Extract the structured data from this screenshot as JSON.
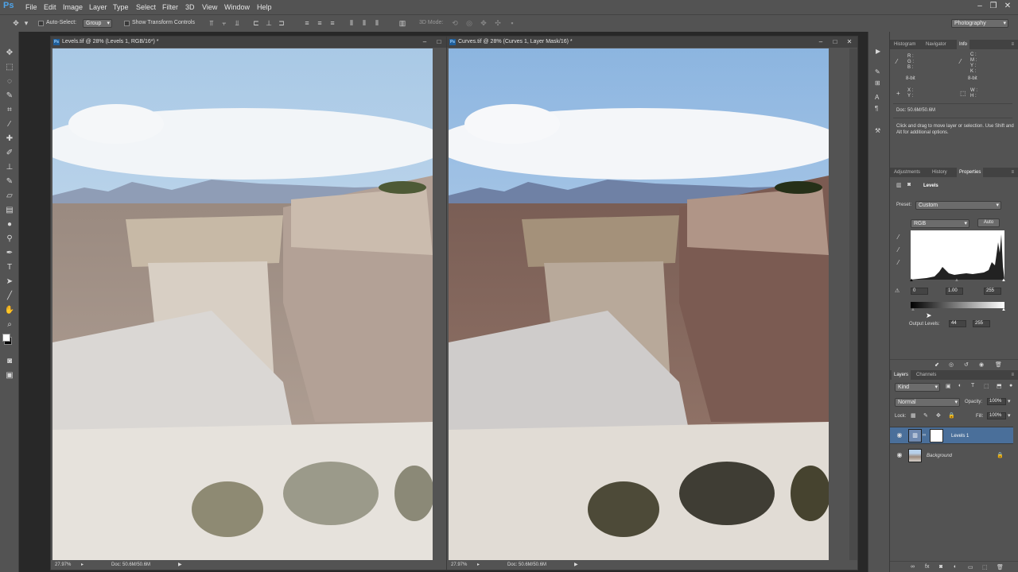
{
  "menubar": {
    "logo": "Ps",
    "items": [
      "File",
      "Edit",
      "Image",
      "Layer",
      "Type",
      "Select",
      "Filter",
      "3D",
      "View",
      "Window",
      "Help"
    ]
  },
  "options": {
    "auto_select": "Auto-Select:",
    "group": "Group",
    "show_transform": "Show Transform Controls",
    "mode3d": "3D Mode:",
    "workspace": "Photography"
  },
  "docs": [
    {
      "title": "Levels.tif @ 28% (Levels 1, RGB/16*) *",
      "zoom": "27.97%",
      "docsize": "Doc: 50.6M/50.6M"
    },
    {
      "title": "Curves.tif @ 28% (Curves 1, Layer Mask/16) *",
      "zoom": "27.97%",
      "docsize": "Doc: 50.6M/50.6M"
    }
  ],
  "info_panel": {
    "tabs": [
      "Histogram",
      "Navigator",
      "Info"
    ],
    "rgb": [
      "R :",
      "G :",
      "B :"
    ],
    "cmyk": [
      "C :",
      "M :",
      "Y :",
      "K :"
    ],
    "bits_left": "8-bit",
    "bits_right": "8-bit",
    "xy": [
      "X :",
      "Y :"
    ],
    "wh": [
      "W :",
      "H :"
    ],
    "doc": "Doc: 50.6M/50.6M",
    "hint": "Click and drag to move layer or selection. Use Shift and Alt for additional options."
  },
  "props_panel": {
    "tabs": [
      "Adjustments",
      "History",
      "Properties"
    ],
    "title": "Levels",
    "preset_label": "Preset:",
    "preset_value": "Custom",
    "channel": "RGB",
    "auto": "Auto",
    "input_black": "0",
    "input_gamma": "1.00",
    "input_white": "255",
    "output_label": "Output Levels:",
    "output_black": "44",
    "output_white": "255"
  },
  "layers_panel": {
    "tabs": [
      "Layers",
      "Channels"
    ],
    "kind": "Kind",
    "blend_mode": "Normal",
    "opacity_label": "Opacity:",
    "opacity": "100%",
    "lock_label": "Lock:",
    "fill_label": "Fill:",
    "fill": "100%",
    "layers": [
      {
        "name": "Levels 1"
      },
      {
        "name": "Background"
      }
    ]
  },
  "colors": {
    "ui_bg": "#535353",
    "workspace": "#282828",
    "selected_layer": "#4a6f9a",
    "ps_blue": "#1f5e9a"
  }
}
